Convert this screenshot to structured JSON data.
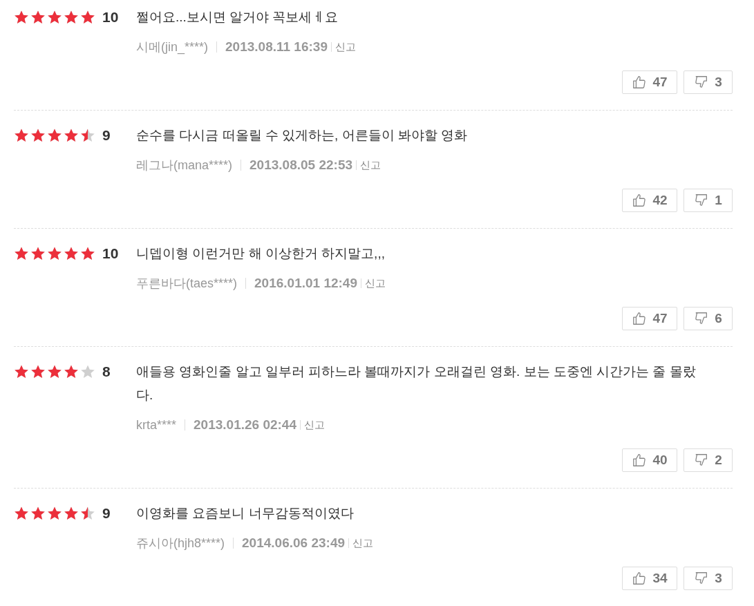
{
  "reviews": [
    {
      "stars": 5,
      "score": "10",
      "text": "쩔어요...보시면 알거야 꼭보세ㅔ요",
      "author": "시메(jin_****)",
      "date": "2013.08.11 16:39",
      "report": "신고",
      "likes": "47",
      "dislikes": "3"
    },
    {
      "stars": 4.5,
      "score": "9",
      "text": "순수를 다시금 떠올릴 수 있게하는, 어른들이 봐야할 영화",
      "author": "레그나(mana****)",
      "date": "2013.08.05 22:53",
      "report": "신고",
      "likes": "42",
      "dislikes": "1"
    },
    {
      "stars": 5,
      "score": "10",
      "text": "니뎁이형 이런거만 해 이상한거 하지말고,,,",
      "author": "푸른바다(taes****)",
      "date": "2016.01.01 12:49",
      "report": "신고",
      "likes": "47",
      "dislikes": "6"
    },
    {
      "stars": 4,
      "score": "8",
      "text": "애들용 영화인줄 알고 일부러 피하느라 볼때까지가 오래걸린 영화. 보는 도중엔 시간가는 줄 몰랐다.",
      "author": "krta****",
      "date": "2013.01.26 02:44",
      "report": "신고",
      "likes": "40",
      "dislikes": "2"
    },
    {
      "stars": 4.5,
      "score": "9",
      "text": "이영화를 요즘보니 너무감동적이였다",
      "author": "쥬시아(hjh8****)",
      "date": "2014.06.06 23:49",
      "report": "신고",
      "likes": "34",
      "dislikes": "3"
    }
  ]
}
